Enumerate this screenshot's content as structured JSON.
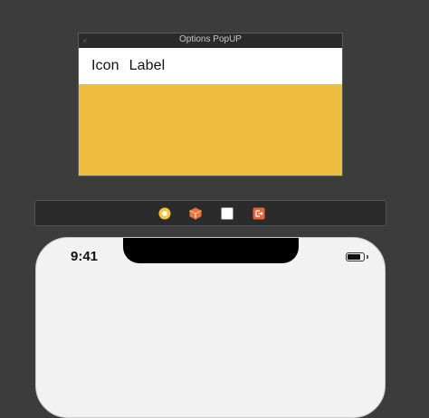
{
  "popup": {
    "title": "Options PopUP",
    "close_glyph": "×",
    "row": {
      "icon_text": "Icon",
      "label_text": "Label"
    },
    "body_color": "#f0bd40"
  },
  "toolbar": {
    "buttons": [
      {
        "icon": "yellow-circle-icon",
        "color": "#f5c542"
      },
      {
        "icon": "orange-cube-icon",
        "color": "#e8743b"
      },
      {
        "icon": "white-square-icon",
        "color": "#ffffff"
      },
      {
        "icon": "orange-exit-icon",
        "color": "#e8643b"
      }
    ]
  },
  "device": {
    "status_time": "9:41",
    "battery_level": 0.8
  }
}
